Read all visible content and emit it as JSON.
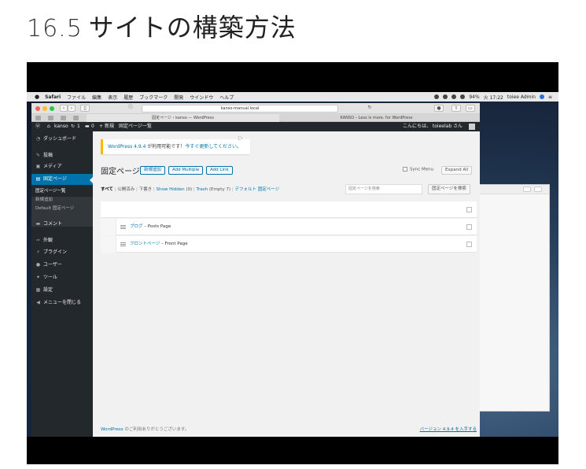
{
  "heading": {
    "number": "16.5",
    "title": "サイトの構築方法"
  },
  "menubar": {
    "items": [
      "Safari",
      "ファイル",
      "編集",
      "表示",
      "履歴",
      "ブックマーク",
      "開発",
      "ウインドウ",
      "ヘルプ"
    ],
    "battery": "94%",
    "time": "火 17:22",
    "user": "toiee Admin"
  },
  "safari": {
    "address": "kanso-manual.local",
    "tabs": [
      "固定ページ ‹ kanso — WordPress",
      "KANSO – Less is more. for WordPress"
    ]
  },
  "wpbar": {
    "site": "kanso",
    "updates": "1",
    "comments": "0",
    "new": "新規",
    "view": "固定ページ一覧",
    "greeting": "こんにちは、 toieelab さん"
  },
  "sidebar": {
    "items": [
      {
        "icon": "dashboard-icon",
        "glyph": "◔",
        "label": "ダッシュボード"
      },
      {
        "icon": "pin-icon",
        "glyph": "✎",
        "label": "投稿"
      },
      {
        "icon": "media-icon",
        "glyph": "▣",
        "label": "メディア"
      },
      {
        "icon": "page-icon",
        "glyph": "▤",
        "label": "固定ページ"
      },
      {
        "icon": "comment-icon",
        "glyph": "▬",
        "label": "コメント"
      },
      {
        "icon": "appearance-icon",
        "glyph": "✑",
        "label": "外観"
      },
      {
        "icon": "plugin-icon",
        "glyph": "⚡",
        "label": "プラグイン"
      },
      {
        "icon": "user-icon",
        "glyph": "●",
        "label": "ユーザー"
      },
      {
        "icon": "tool-icon",
        "glyph": "✦",
        "label": "ツール"
      },
      {
        "icon": "settings-icon",
        "glyph": "▦",
        "label": "設定"
      },
      {
        "icon": "collapse-icon",
        "glyph": "◀",
        "label": "メニューを閉じる"
      }
    ],
    "sub": [
      "固定ページ一覧",
      "新規追加",
      "Default 固定ページ"
    ]
  },
  "main": {
    "notice_version": "WordPress 4.9.4",
    "notice_text": " が利用可能です！",
    "notice_link": "今すぐ更新してください。",
    "title": "固定ページ",
    "buttons": {
      "add_new": "新規追加",
      "add_multiple": "Add Multiple",
      "add_link": "Add Link",
      "expand_all": "Expand All"
    },
    "sync_menu": "Sync Menu",
    "filters": {
      "all": "すべて",
      "published": "公開済み",
      "draft": "下書き",
      "show_hidden": "Show Hidden",
      "show_hidden_count": "(0)",
      "trash": "Trash",
      "trash_count": "(Empty 7)",
      "default": "デフォルト 固定ページ"
    },
    "search_placeholder": "固定ページを検索",
    "search_button": "固定ページを検索",
    "rows": [
      {
        "title": "ブログ",
        "desc": " – Posts Page"
      },
      {
        "title": "フロントページ",
        "desc": " – Front Page"
      }
    ],
    "footer_link": "WordPress",
    "footer_text": " のご利用ありがとうございます。",
    "footer_version": "バージョン 4.9.4 を入手する"
  }
}
